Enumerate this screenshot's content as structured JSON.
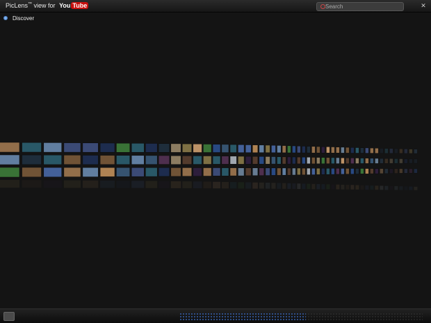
{
  "app": {
    "title_prefix": "PicLens",
    "trademark": "™",
    "title_mid": "view for",
    "logo_you": "You",
    "logo_tube": "Tube"
  },
  "search": {
    "placeholder": "Search"
  },
  "window": {
    "close": "✕"
  },
  "nav": {
    "discover_label": "Discover"
  },
  "colors": {
    "accent_blue": "#3b6fd0",
    "youtube_red": "#c8100e",
    "background": "#141414"
  },
  "icons": [
    "search-icon",
    "discover-icon",
    "close-icon",
    "slideshow-icon"
  ]
}
